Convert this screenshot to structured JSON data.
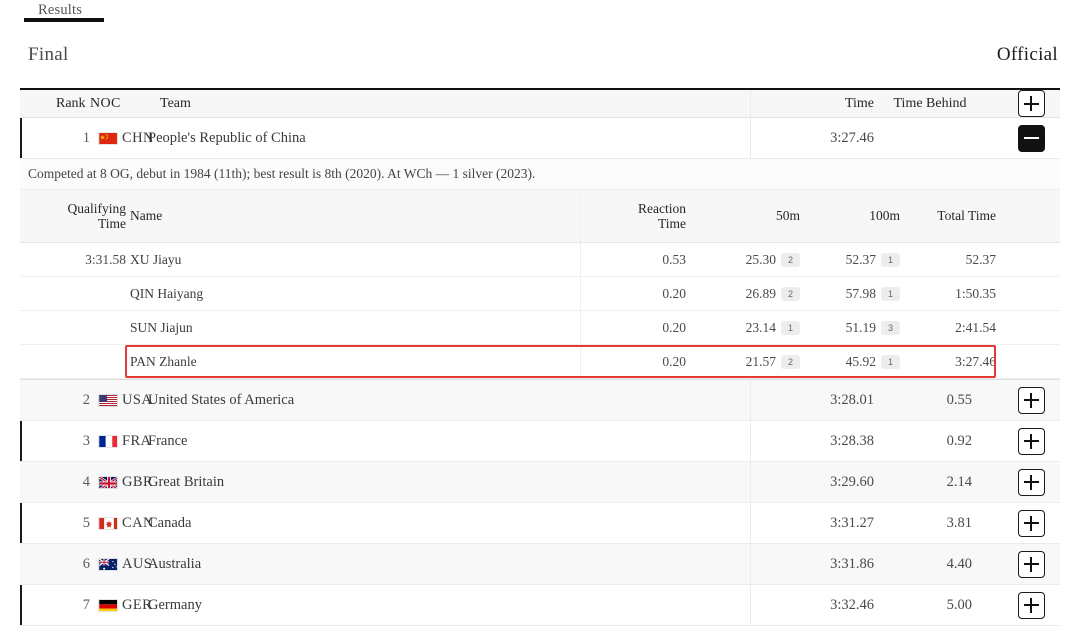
{
  "tabs": [
    {
      "label": "Results",
      "active": true
    }
  ],
  "section": {
    "title": "Final",
    "status": "Official"
  },
  "main_table": {
    "headers": {
      "rank": "Rank",
      "noc": "NOC",
      "team": "Team",
      "time": "Time",
      "time_behind": "Time Behind",
      "expand_all": "+"
    },
    "rows": [
      {
        "rank": "1",
        "noc": "CHN",
        "flag": "cn-flag-icon",
        "team": "People's Republic of China",
        "time": "3:27.46",
        "time_behind": "",
        "action": "−",
        "expanded": true
      },
      {
        "rank": "2",
        "noc": "USA",
        "flag": "us-flag-icon",
        "team": "United States of America",
        "time": "3:28.01",
        "time_behind": "0.55",
        "action": "+",
        "expanded": false
      },
      {
        "rank": "3",
        "noc": "FRA",
        "flag": "fr-flag-icon",
        "team": "France",
        "time": "3:28.38",
        "time_behind": "0.92",
        "action": "+",
        "expanded": false
      },
      {
        "rank": "4",
        "noc": "GBR",
        "flag": "gb-flag-icon",
        "team": "Great Britain",
        "time": "3:29.60",
        "time_behind": "2.14",
        "action": "+",
        "expanded": false
      },
      {
        "rank": "5",
        "noc": "CAN",
        "flag": "ca-flag-icon",
        "team": "Canada",
        "time": "3:31.27",
        "time_behind": "3.81",
        "action": "+",
        "expanded": false
      },
      {
        "rank": "6",
        "noc": "AUS",
        "flag": "au-flag-icon",
        "team": "Australia",
        "time": "3:31.86",
        "time_behind": "4.40",
        "action": "+",
        "expanded": false
      },
      {
        "rank": "7",
        "noc": "GER",
        "flag": "de-flag-icon",
        "team": "Germany",
        "time": "3:32.46",
        "time_behind": "5.00",
        "action": "+",
        "expanded": false
      }
    ]
  },
  "detail": {
    "note": "Competed at 8 OG, debut in 1984 (11th); best result is 8th (2020). At WCh — 1 silver (2023).",
    "headers": {
      "qualifying_time_l1": "Qualifying",
      "qualifying_time_l2": "Time",
      "name": "Name",
      "reaction_time_l1": "Reaction",
      "reaction_time_l2": "Time",
      "split_50m": "50m",
      "split_100m": "100m",
      "total_time": "Total Time"
    },
    "athletes": [
      {
        "qualifying_time": "3:31.58",
        "name": "XU Jiayu",
        "reaction_time": "0.53",
        "split_50m": "25.30",
        "split_50m_rank": "2",
        "split_100m": "52.37",
        "split_100m_rank": "1",
        "total_time": "52.37",
        "highlighted": false
      },
      {
        "qualifying_time": "",
        "name": "QIN Haiyang",
        "reaction_time": "0.20",
        "split_50m": "26.89",
        "split_50m_rank": "2",
        "split_100m": "57.98",
        "split_100m_rank": "1",
        "total_time": "1:50.35",
        "highlighted": false
      },
      {
        "qualifying_time": "",
        "name": "SUN Jiajun",
        "reaction_time": "0.20",
        "split_50m": "23.14",
        "split_50m_rank": "1",
        "split_100m": "51.19",
        "split_100m_rank": "3",
        "total_time": "2:41.54",
        "highlighted": false
      },
      {
        "qualifying_time": "",
        "name": "PAN Zhanle",
        "reaction_time": "0.20",
        "split_50m": "21.57",
        "split_50m_rank": "2",
        "split_100m": "45.92",
        "split_100m_rank": "1",
        "total_time": "3:27.46",
        "highlighted": true
      }
    ]
  },
  "colors": {
    "highlight_border": "#e23b35",
    "accent_bar": "#1a1a1a",
    "tab_underline": "#111111"
  }
}
